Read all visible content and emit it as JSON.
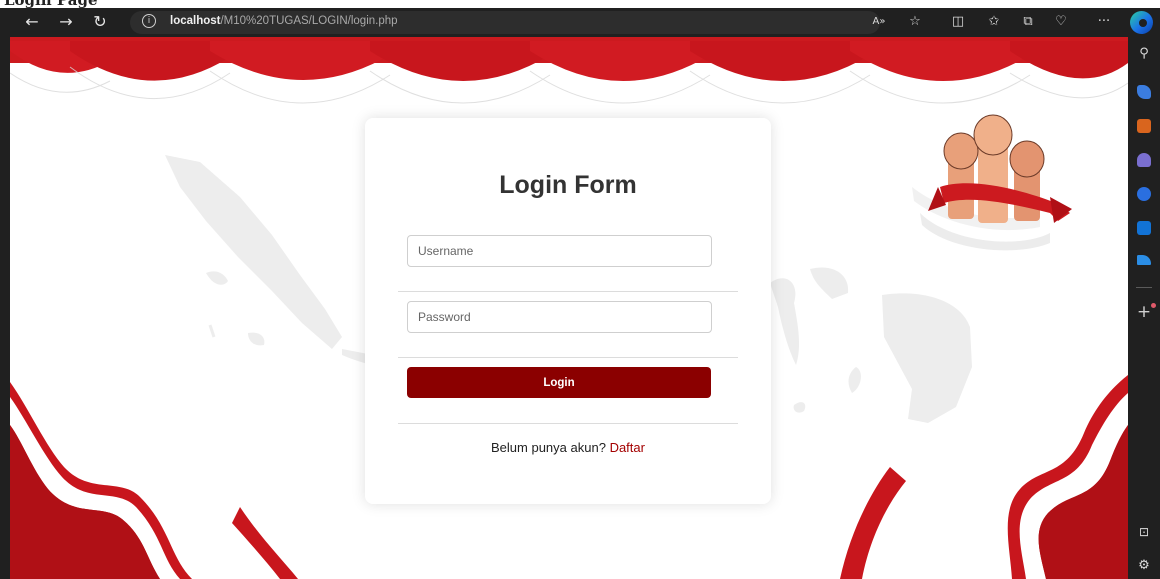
{
  "window": {
    "title_fragment": "Login Page"
  },
  "browser": {
    "url_host": "localhost",
    "url_path": "/M10%20TUGAS/LOGIN/login.php"
  },
  "form": {
    "title": "Login Form",
    "username_placeholder": "Username",
    "password_placeholder": "Password",
    "login_label": "Login",
    "register_prompt": "Belum punya akun?",
    "register_link": "Daftar"
  },
  "colors": {
    "accent": "#8b0000",
    "flag_red": "#cc1a1f",
    "browser_chrome": "#202020"
  },
  "icons": {
    "toolbar": [
      "back-icon",
      "forward-icon",
      "refresh-icon",
      "info-icon",
      "read-aloud-icon",
      "favorite-star-icon",
      "split-screen-icon",
      "favorites-icon",
      "collections-icon",
      "performance-icon",
      "more-icon",
      "edge-logo"
    ],
    "sidebar": [
      "search-icon",
      "shopping-tag-icon",
      "tools-icon",
      "games-icon",
      "copilot-icon",
      "outlook-icon",
      "send-icon",
      "add-icon",
      "screenshot-icon",
      "settings-icon"
    ]
  }
}
